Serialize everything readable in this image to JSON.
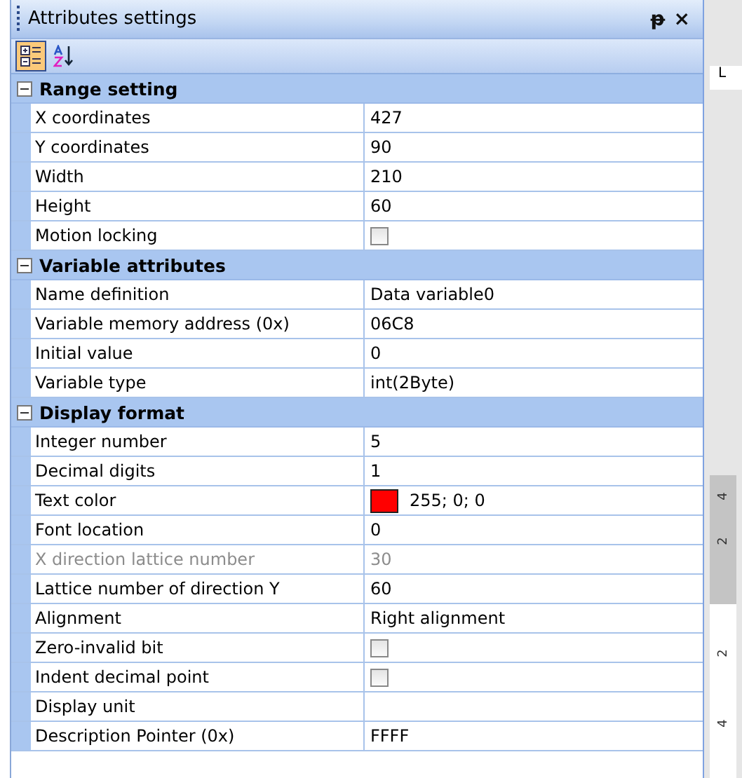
{
  "window": {
    "title": "Attributes settings",
    "pin": "ᵽ",
    "close": "×"
  },
  "toolbar": [
    {
      "kind": "categorized",
      "selected": true
    },
    {
      "kind": "alphabetical",
      "selected": false
    }
  ],
  "categories": [
    {
      "name": "Range setting",
      "expanded": true,
      "rows": [
        {
          "name": "X coordinates",
          "kind": "text",
          "value": "427",
          "disabled": false
        },
        {
          "name": "Y coordinates",
          "kind": "text",
          "value": "90",
          "disabled": false
        },
        {
          "name": "Width",
          "kind": "text",
          "value": "210",
          "disabled": false
        },
        {
          "name": "Height",
          "kind": "text",
          "value": "60",
          "disabled": false
        },
        {
          "name": "Motion locking",
          "kind": "checkbox",
          "checked": false,
          "disabled": false
        }
      ]
    },
    {
      "name": "Variable attributes",
      "expanded": true,
      "rows": [
        {
          "name": "Name definition",
          "kind": "text",
          "value": "Data variable0",
          "disabled": false
        },
        {
          "name": "Variable memory address (0x)",
          "kind": "text",
          "value": "06C8",
          "disabled": false
        },
        {
          "name": "Initial value",
          "kind": "text",
          "value": "0",
          "disabled": false
        },
        {
          "name": "Variable type",
          "kind": "text",
          "value": "int(2Byte)",
          "disabled": false
        }
      ]
    },
    {
      "name": "Display format",
      "expanded": true,
      "rows": [
        {
          "name": "Integer number",
          "kind": "text",
          "value": "5",
          "disabled": false
        },
        {
          "name": "Decimal digits",
          "kind": "text",
          "value": "1",
          "disabled": false
        },
        {
          "name": "Text color",
          "kind": "color",
          "color": "#ff0000",
          "value": "255; 0; 0",
          "disabled": false
        },
        {
          "name": "Font location",
          "kind": "text",
          "value": "0",
          "disabled": false
        },
        {
          "name": "X direction lattice number",
          "kind": "text",
          "value": "30",
          "disabled": true
        },
        {
          "name": "Lattice number of direction Y",
          "kind": "text",
          "value": "60",
          "disabled": false
        },
        {
          "name": "Alignment",
          "kind": "text",
          "value": "Right alignment",
          "disabled": false
        },
        {
          "name": "Zero-invalid bit",
          "kind": "checkbox",
          "checked": false,
          "disabled": false
        },
        {
          "name": "Indent decimal point",
          "kind": "checkbox",
          "checked": false,
          "disabled": false
        },
        {
          "name": "Display unit",
          "kind": "text",
          "disabled": false
        },
        {
          "name": "Description Pointer (0x)",
          "kind": "text",
          "value": "FFFF",
          "disabled": false
        }
      ]
    }
  ],
  "ruler": {
    "corner": "L",
    "labels": [
      "4",
      "2",
      "2",
      "4"
    ]
  }
}
